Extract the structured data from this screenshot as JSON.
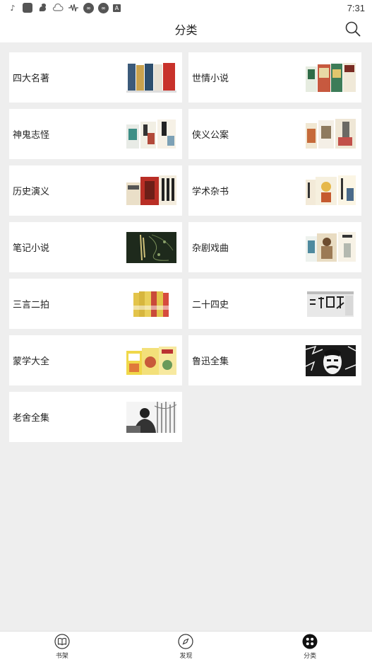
{
  "status_bar": {
    "time": "7:31",
    "icons": [
      "tiktok-icon",
      "app-square-icon",
      "squirrel-icon",
      "cloud-icon",
      "waveform-icon",
      "circle-app-icon",
      "circle-app-icon",
      "font-a-icon"
    ]
  },
  "header": {
    "title": "分类",
    "search_icon": "search-icon"
  },
  "categories": [
    {
      "label": "四大名著",
      "thumb": "books-four-classics"
    },
    {
      "label": "世情小说",
      "thumb": "books-social-novels"
    },
    {
      "label": "神鬼志怪",
      "thumb": "books-supernatural"
    },
    {
      "label": "侠义公案",
      "thumb": "books-chivalry"
    },
    {
      "label": "历史演义",
      "thumb": "books-historical"
    },
    {
      "label": "学术杂书",
      "thumb": "books-academic"
    },
    {
      "label": "笔记小说",
      "thumb": "books-notes-novels"
    },
    {
      "label": "杂剧戏曲",
      "thumb": "books-opera"
    },
    {
      "label": "三言二拍",
      "thumb": "books-sanyan-erpai"
    },
    {
      "label": "二十四史",
      "thumb": "books-24-histories"
    },
    {
      "label": "蒙学大全",
      "thumb": "books-primers"
    },
    {
      "label": "鲁迅全集",
      "thumb": "portrait-luxun"
    },
    {
      "label": "老舍全集",
      "thumb": "photo-laoshe"
    }
  ],
  "bottom_nav": [
    {
      "label": "书架",
      "icon": "book-open-icon",
      "active": false
    },
    {
      "label": "发现",
      "icon": "compass-icon",
      "active": false
    },
    {
      "label": "分类",
      "icon": "grid-dots-icon",
      "active": true
    }
  ]
}
